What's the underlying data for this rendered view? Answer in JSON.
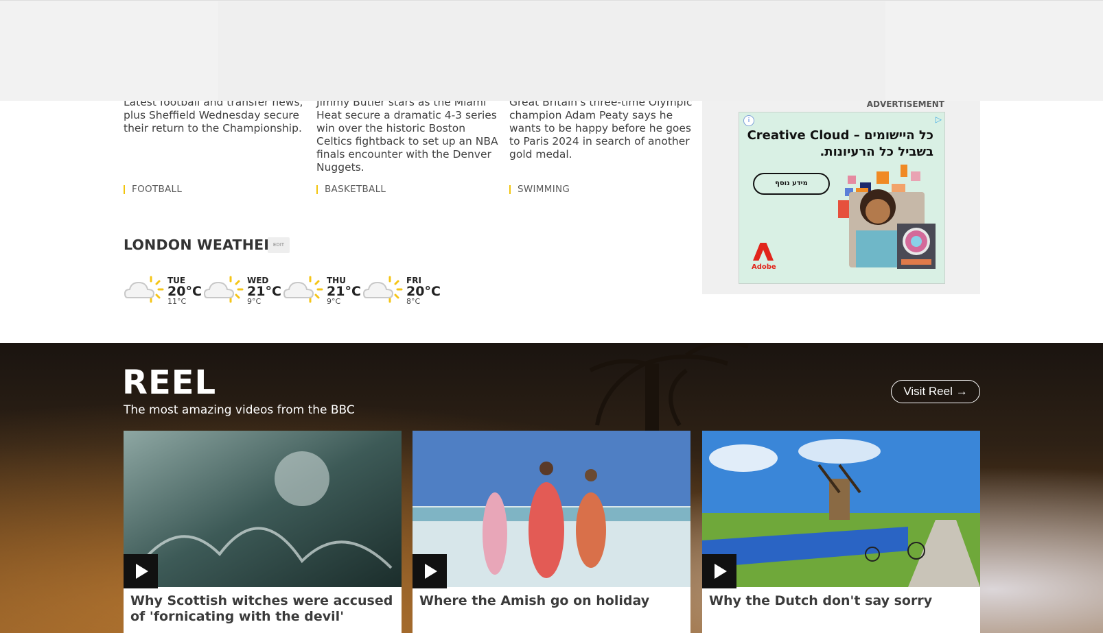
{
  "stories": [
    {
      "summary": "Latest football and transfer news, plus Sheffield Wednesday secure their return to the Championship.",
      "tag": "FOOTBALL"
    },
    {
      "summary": "Jimmy Butler stars as the Miami Heat secure a dramatic 4-3 series win over the historic Boston Celtics fightback to set up an NBA finals encounter with the Denver Nuggets.",
      "tag": "BASKETBALL"
    },
    {
      "summary": "Great Britain's three-time Olympic champion Adam Peaty says he wants to be happy before he goes to Paris 2024 in search of another gold medal.",
      "tag": "SWIMMING"
    }
  ],
  "weather": {
    "title": "LONDON WEATHER",
    "edit_label": "EDIT",
    "days": [
      {
        "day": "TUE",
        "high": "20°C",
        "low": "11°C",
        "icon": "sun-cloud-icon"
      },
      {
        "day": "WED",
        "high": "21°C",
        "low": "9°C",
        "icon": "sun-cloud-icon"
      },
      {
        "day": "THU",
        "high": "21°C",
        "low": "9°C",
        "icon": "sun-cloud-icon"
      },
      {
        "day": "FRI",
        "high": "20°C",
        "low": "8°C",
        "icon": "sun-cloud-icon"
      }
    ]
  },
  "advert": {
    "label": "ADVERTISEMENT",
    "headline": "כל היישומים – Creative Cloud בשביל כל הרעיונות.",
    "button": "מידע נוסף",
    "brand": "Adobe"
  },
  "reel": {
    "title": "REEL",
    "subtitle": "The most amazing videos from the BBC",
    "visit_label": "Visit Reel",
    "cards": [
      {
        "title": "Why Scottish witches were accused of 'fornicating with the devil'"
      },
      {
        "title": "Where the Amish go on holiday"
      },
      {
        "title": "Why the Dutch don't say sorry"
      }
    ]
  },
  "colors": {
    "tag_accent": "#f2c40c",
    "adobe_red": "#e1251b",
    "ad_bg": "#d9f0e4"
  }
}
